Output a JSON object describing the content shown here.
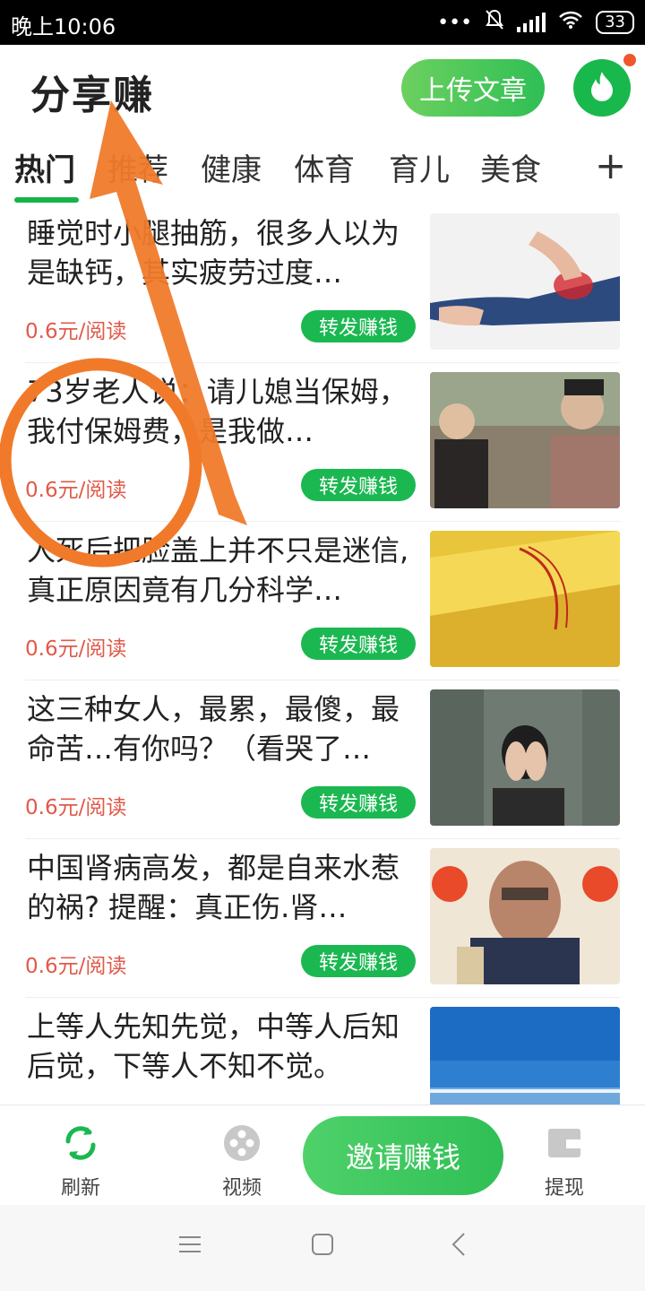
{
  "status_bar": {
    "time": "晚上10:06",
    "battery": "33"
  },
  "header": {
    "title": "分享赚",
    "upload_label": "上传文章"
  },
  "tabs": [
    "热门",
    "推荐",
    "健康",
    "体育",
    "育儿",
    "美食"
  ],
  "feed": [
    {
      "title": "睡觉时小腿抽筋，很多人以为是缺钙，其实疲劳过度…",
      "price": "0.6元/阅读",
      "share": "转发赚钱",
      "thumb": "leg-cramp-photo"
    },
    {
      "title": "73岁老人说：请儿媳当保姆，我付保姆费，是我做…",
      "price": "0.6元/阅读",
      "share": "转发赚钱",
      "thumb": "elderly-women-photo"
    },
    {
      "title": "人死后把脸盖上并不只是迷信,真正原因竟有几分科学…",
      "price": "0.6元/阅读",
      "share": "转发赚钱",
      "thumb": "yellow-paper-photo"
    },
    {
      "title": "这三种女人，最累，最傻，最命苦…有你吗？（看哭了…",
      "price": "0.6元/阅读",
      "share": "转发赚钱",
      "thumb": "woman-covering-face-photo"
    },
    {
      "title": "中国肾病高发，都是自来水惹的祸? 提醒：真正伤.肾…",
      "price": "0.6元/阅读",
      "share": "转发赚钱",
      "thumb": "old-man-photo"
    },
    {
      "title": "上等人先知先觉，中等人后知后觉，下等人不知不觉。",
      "price": "",
      "share": "",
      "thumb": "sea-sky-photo"
    }
  ],
  "bottom_nav": {
    "refresh": "刷新",
    "video": "视频",
    "invite": "邀请赚钱",
    "withdraw": "提现"
  },
  "colors": {
    "brand_green": "#1bb851",
    "price_red": "#e05a4a",
    "annotation_orange": "#f07a2a"
  }
}
